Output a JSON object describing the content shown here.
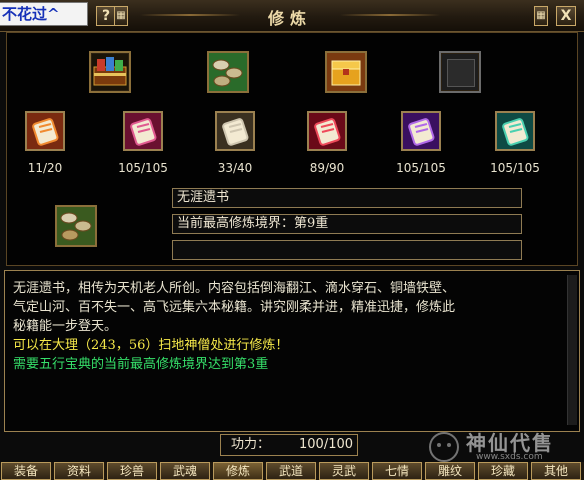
{
  "window": {
    "player_name": "不花过^",
    "title": "修炼",
    "help_button": "?",
    "close_button": "X"
  },
  "top_items": [
    {
      "name": "book-chest-icon"
    },
    {
      "name": "green-scroll-bundle-icon"
    },
    {
      "name": "gold-chest-icon"
    },
    {
      "name": "empty-slot"
    }
  ],
  "skills": [
    {
      "icon": "orange-scroll-icon",
      "progress": "11/20",
      "fill": 0.55
    },
    {
      "icon": "pink-scroll-icon",
      "progress": "105/105",
      "fill": 1.0
    },
    {
      "icon": "gray-scroll-icon",
      "progress": "33/40",
      "fill": 0.825
    },
    {
      "icon": "red-scroll-icon",
      "progress": "89/90",
      "fill": 0.989
    },
    {
      "icon": "purple-scroll-icon",
      "progress": "105/105",
      "fill": 1.0
    },
    {
      "icon": "teal-scroll-icon",
      "progress": "105/105",
      "fill": 1.0
    }
  ],
  "selected": {
    "icon": "scroll-bundle-icon",
    "name": "无涯遗书",
    "realm": "当前最高修炼境界：第9重",
    "extra": ""
  },
  "description": {
    "line1": "无涯遗书，相传为天机老人所创。内容包括倒海翻江、滴水穿石、铜墙铁壁、",
    "line2": "气定山河、百不失一、高飞远集六本秘籍。讲究刚柔并进，精准迅捷，修炼此",
    "line3": "秘籍能一步登天。",
    "location_hint": "可以在大理（243，56）扫地神僧处进行修炼！",
    "requirement": "需要五行宝典的当前最高修炼境界达到第3重"
  },
  "power": {
    "label": "功力：",
    "value": "100/100"
  },
  "tabs": [
    {
      "label": "装备"
    },
    {
      "label": "资料"
    },
    {
      "label": "珍兽"
    },
    {
      "label": "武魂"
    },
    {
      "label": "修炼"
    },
    {
      "label": "武道"
    },
    {
      "label": "灵武"
    },
    {
      "label": "七情"
    },
    {
      "label": "雕纹"
    },
    {
      "label": "珍藏"
    },
    {
      "label": "其他"
    }
  ],
  "watermark": {
    "brand": "神仙代售",
    "url": "www.sxds.com"
  },
  "colors": {
    "text_white": "#e8e3cf",
    "text_yellow": "#f6e94a",
    "text_green": "#36e06a",
    "gold_border": "#9c8250"
  }
}
